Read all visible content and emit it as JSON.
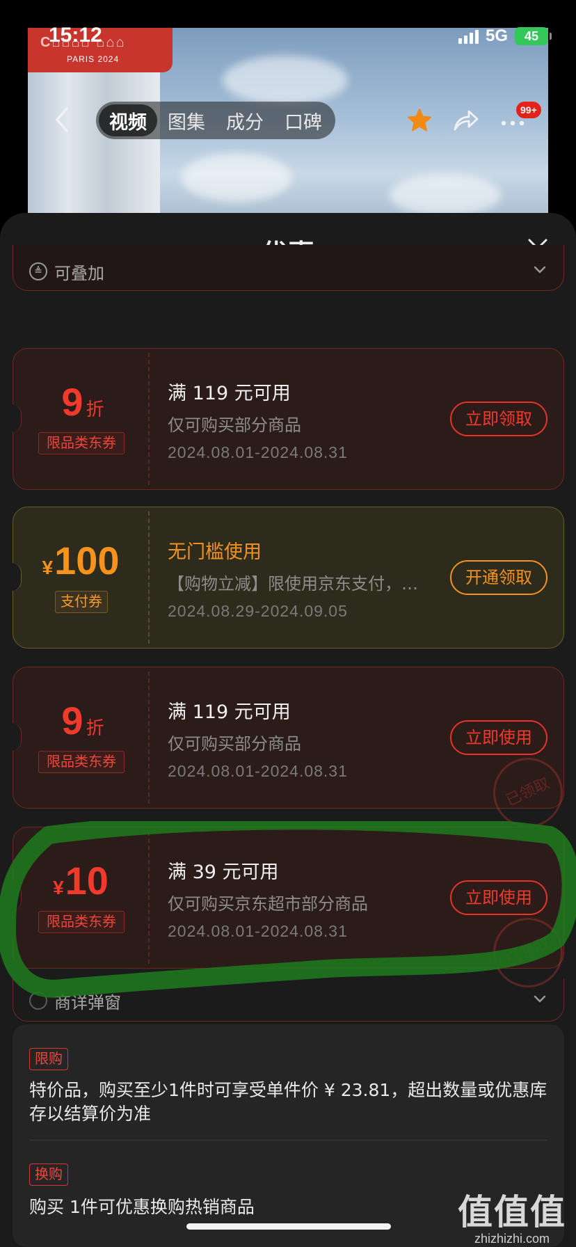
{
  "status_bar": {
    "time": "15:12",
    "network": "5G",
    "battery": "45"
  },
  "banner": {
    "brand_sub": "PARIS 2024"
  },
  "nav": {
    "tabs": [
      {
        "label": "视频",
        "active": true
      },
      {
        "label": "图集",
        "active": false
      },
      {
        "label": "成分",
        "active": false
      },
      {
        "label": "口碑",
        "active": false
      }
    ],
    "badge": "99+"
  },
  "sheet": {
    "title": "优惠",
    "stack_row": {
      "label": "可叠加"
    },
    "coupons": [
      {
        "style": "red",
        "amount": "9",
        "amount_unit": "折",
        "currency": "",
        "tag": "限品类东券",
        "condition": "满 119 元可用",
        "desc": "仅可购买部分商品",
        "date": "2024.08.01-2024.08.31",
        "action": "立即领取",
        "stamp": ""
      },
      {
        "style": "gold",
        "amount": "100",
        "amount_unit": "",
        "currency": "¥",
        "tag": "支付券",
        "condition": "无门槛使用",
        "desc": "【购物立减】限使用京东支付，…",
        "date": "2024.08.29-2024.09.05",
        "action": "开通领取",
        "stamp": ""
      },
      {
        "style": "red",
        "amount": "9",
        "amount_unit": "折",
        "currency": "",
        "tag": "限品类东券",
        "condition": "满 119 元可用",
        "desc": "仅可购买部分商品",
        "date": "2024.08.01-2024.08.31",
        "action": "立即使用",
        "stamp": "已领取"
      },
      {
        "style": "red",
        "amount": "10",
        "amount_unit": "",
        "currency": "¥",
        "tag": "限品类东券",
        "condition": "满 39 元可用",
        "desc": "仅可购买京东超市部分商品",
        "date": "2024.08.01-2024.08.31",
        "action": "立即使用",
        "stamp": "已领取"
      }
    ],
    "popup_row": {
      "label": "商详弹窗"
    },
    "limits": [
      {
        "tag": "限购",
        "text": "特价品，购买至少1件时可享受单件价 ¥ 23.81，超出数量或优惠库存以结算价为准"
      },
      {
        "tag": "换购",
        "text": "购买 1件可优惠换购热销商品"
      }
    ]
  },
  "watermark": {
    "big": "值值值",
    "small": "zhizhizhi.com"
  },
  "colors": {
    "accent_red": "#f23a2c",
    "accent_gold": "#f7921d",
    "sheet_bg": "#1b1b1b"
  }
}
